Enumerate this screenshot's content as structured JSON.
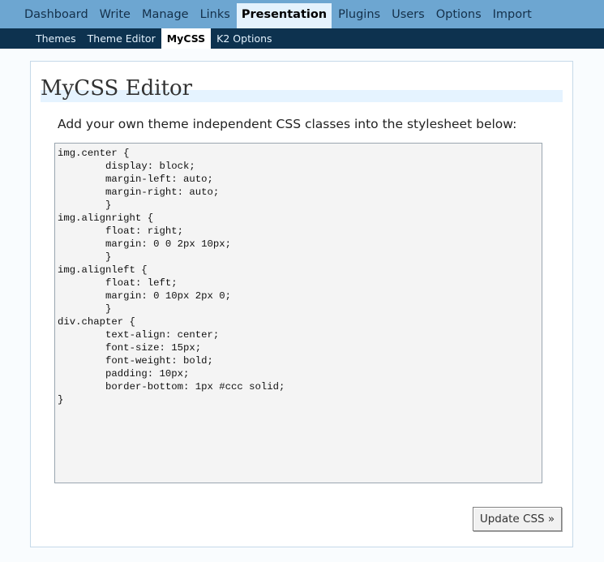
{
  "nav": {
    "top_items": [
      {
        "id": "dashboard",
        "label": "Dashboard"
      },
      {
        "id": "write",
        "label": "Write"
      },
      {
        "id": "manage",
        "label": "Manage"
      },
      {
        "id": "links",
        "label": "Links"
      },
      {
        "id": "presentation",
        "label": "Presentation"
      },
      {
        "id": "plugins",
        "label": "Plugins"
      },
      {
        "id": "users",
        "label": "Users"
      },
      {
        "id": "options",
        "label": "Options"
      },
      {
        "id": "import",
        "label": "Import"
      }
    ],
    "active_top": "Presentation",
    "sub_items": [
      {
        "id": "themes",
        "label": "Themes"
      },
      {
        "id": "theme-editor",
        "label": "Theme Editor"
      },
      {
        "id": "mycss",
        "label": "MyCSS"
      },
      {
        "id": "k2-options",
        "label": "K2 Options"
      }
    ],
    "active_sub": "MyCSS"
  },
  "main": {
    "title": "MyCSS Editor",
    "intro": "Add your own theme independent CSS classes into the stylesheet below:",
    "css_content": "img.center {\n\tdisplay: block;\n\tmargin-left: auto;\n\tmargin-right: auto;\n\t}\nimg.alignright {\n\tfloat: right;\n\tmargin: 0 0 2px 10px;\n\t}\nimg.alignleft {\n\tfloat: left;\n\tmargin: 0 10px 2px 0;\n\t}\ndiv.chapter {\n\ttext-align: center;\n\tfont-size: 15px;\n\tfont-weight: bold;\n\tpadding: 10px;\n\tborder-bottom: 1px #ccc solid;\n}",
    "update_button_label": "Update CSS »"
  },
  "colors": {
    "top_bar": "#6da6d1",
    "sub_bar": "#0d324f",
    "active_tab": "#e4f2fd"
  }
}
